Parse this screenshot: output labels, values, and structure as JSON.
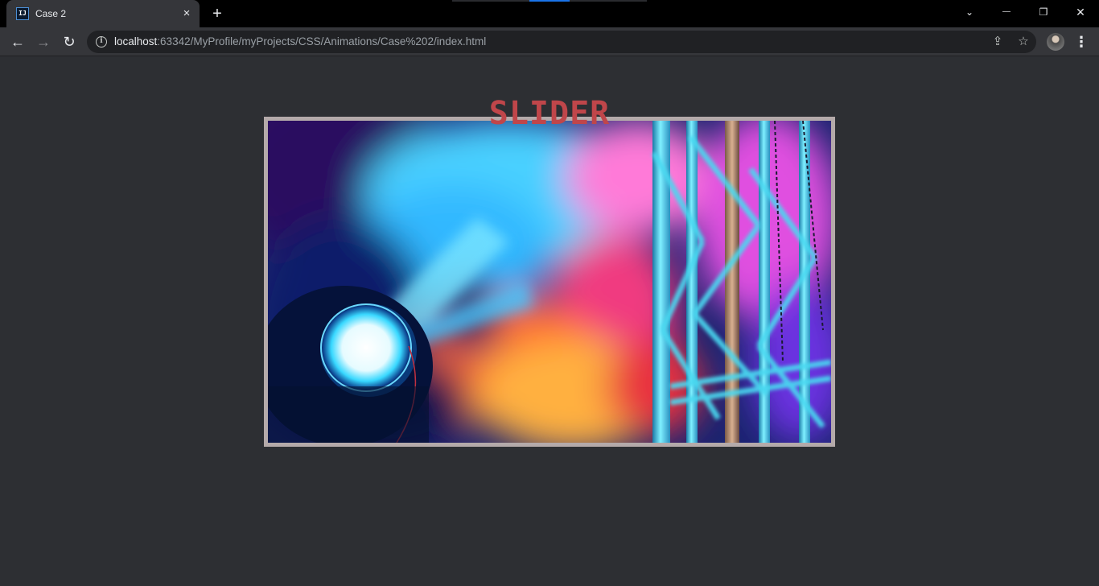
{
  "browser": {
    "tab": {
      "title": "Case 2",
      "favicon": "IJ",
      "close_icon": "×"
    },
    "new_tab_icon": "+",
    "window_controls": {
      "tab_search": "⌄",
      "minimize": "—",
      "restore": "❐",
      "close": "✕"
    },
    "nav": {
      "back": "←",
      "forward": "→",
      "reload": "↻"
    },
    "address": {
      "host": "localhost",
      "rest": ":63342/MyProfile/myProjects/CSS/Animations/Case%202/index.html",
      "info_icon": "i"
    },
    "share_icon": "⇪",
    "bookmark_icon": "☆",
    "menu_icon": "⋮"
  },
  "page": {
    "title": "SLIDER",
    "title_color": "#c0464a",
    "frame_color": "#b4aaaa",
    "background": "#2d2f33",
    "slide_image": "concert-stage-spotlight-truss"
  }
}
